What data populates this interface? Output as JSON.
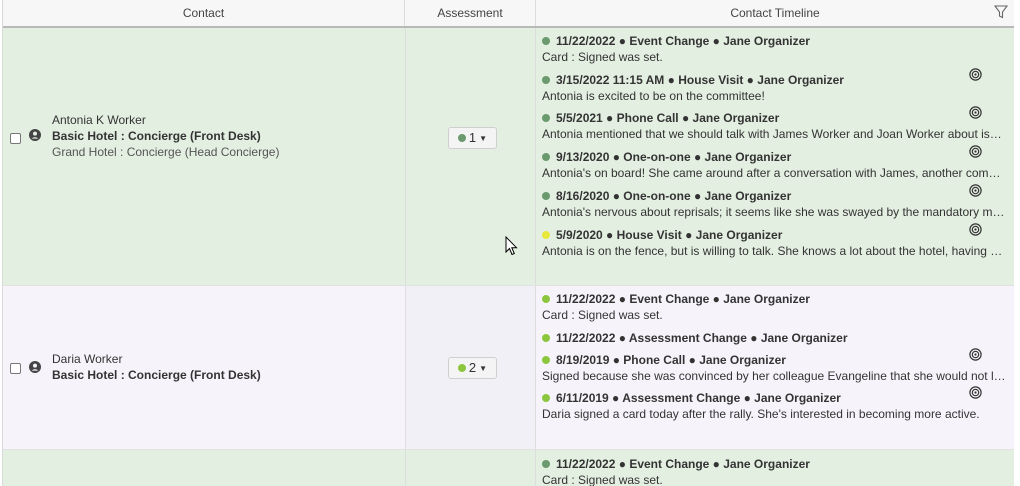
{
  "headers": {
    "contact": "Contact",
    "assessment": "Assessment",
    "timeline": "Contact Timeline"
  },
  "colors": {
    "green_dot": "#6a9a6e",
    "yellow_dot": "#e8e83c",
    "lime_dot": "#8cc63f"
  },
  "rows": [
    {
      "contact": {
        "name": "Antonia K Worker",
        "primary": "Basic Hotel : Concierge (Front Desk)",
        "secondary": "Grand Hotel : Concierge (Head Concierge)"
      },
      "assessment": {
        "value": "1",
        "color": "#6a9a6e"
      },
      "timeline": [
        {
          "head": "11/22/2022 ● Event Change ● Jane Organizer",
          "detail": "Card : Signed was set.",
          "dot": "#6a9a6e",
          "target": false
        },
        {
          "head": "3/15/2022 11:15 AM ● House Visit ● Jane Organizer",
          "detail": "Antonia is excited to be on the committee!",
          "dot": "#6a9a6e",
          "target": true
        },
        {
          "head": "5/5/2021 ● Phone Call ● Jane Organizer",
          "detail": "Antonia mentioned that we should talk with James Worker and Joan Worker about issu...",
          "dot": "#6a9a6e",
          "target": true
        },
        {
          "head": "9/13/2020 ● One-on-one ● Jane Organizer",
          "detail": "Antonia's on board! She came around after a conversation with James, another committ...",
          "dot": "#6a9a6e",
          "target": true
        },
        {
          "head": "8/16/2020 ● One-on-one ● Jane Organizer",
          "detail": "Antonia's nervous about reprisals; it seems like she was swayed by the mandatory mee...",
          "dot": "#6a9a6e",
          "target": true
        },
        {
          "head": "5/9/2020 ● House Visit ● Jane Organizer",
          "detail": "Antonia is on the fence, but is willing to talk. She knows a lot about the hotel, having wo...",
          "dot": "#e8e83c",
          "target": true
        }
      ]
    },
    {
      "contact": {
        "name": "Daria Worker",
        "primary": "Basic Hotel : Concierge (Front Desk)",
        "secondary": ""
      },
      "assessment": {
        "value": "2",
        "color": "#8cc63f"
      },
      "timeline": [
        {
          "head": "11/22/2022 ● Event Change ● Jane Organizer",
          "detail": "Card : Signed was set.",
          "dot": "#8cc63f",
          "target": false
        },
        {
          "head": "11/22/2022 ● Assessment Change ● Jane Organizer",
          "detail": "",
          "dot": "#8cc63f",
          "target": false
        },
        {
          "head": "8/19/2019 ● Phone Call ● Jane Organizer",
          "detail": "Signed because she was convinced by her colleague Evangeline that she would not los...",
          "dot": "#8cc63f",
          "target": true
        },
        {
          "head": "6/11/2019 ● Assessment Change ● Jane Organizer",
          "detail": "Daria signed a card today after the rally. She's interested in becoming more active.",
          "dot": "#8cc63f",
          "target": true
        }
      ]
    },
    {
      "contact": {
        "name": "",
        "primary": "",
        "secondary": ""
      },
      "assessment": {
        "value": "",
        "color": "#6a9a6e"
      },
      "timeline": [
        {
          "head": "11/22/2022 ● Event Change ● Jane Organizer",
          "detail": "Card : Signed was set.",
          "dot": "#6a9a6e",
          "target": false
        }
      ]
    }
  ]
}
